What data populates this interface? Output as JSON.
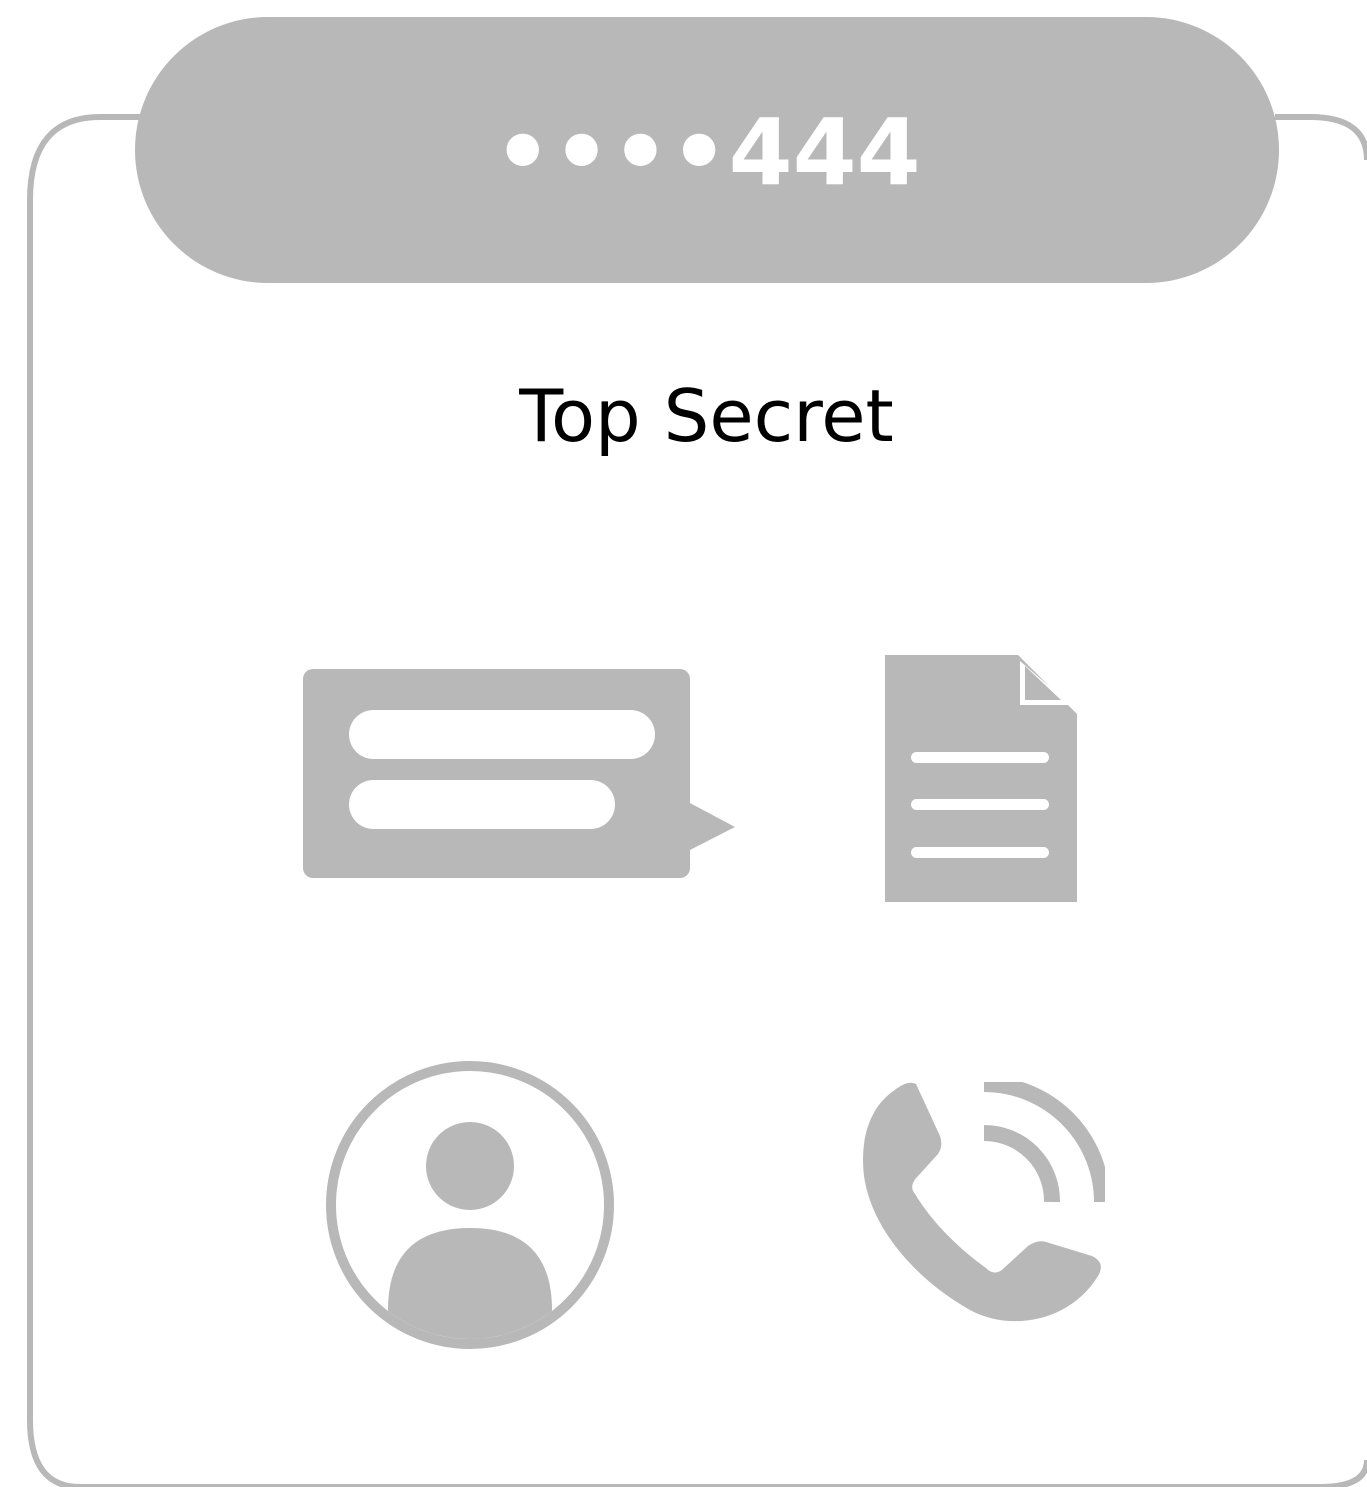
{
  "card": {
    "number": "••••444",
    "title": "Top Secret",
    "colors": {
      "accent": "#b8b8b8",
      "border": "#b8b8b8",
      "background": "#ffffff",
      "title_text": "#000000",
      "number_text": "#ffffff"
    }
  },
  "icons": [
    {
      "name": "message-icon"
    },
    {
      "name": "document-icon"
    },
    {
      "name": "contact-icon"
    },
    {
      "name": "phone-call-icon"
    }
  ]
}
